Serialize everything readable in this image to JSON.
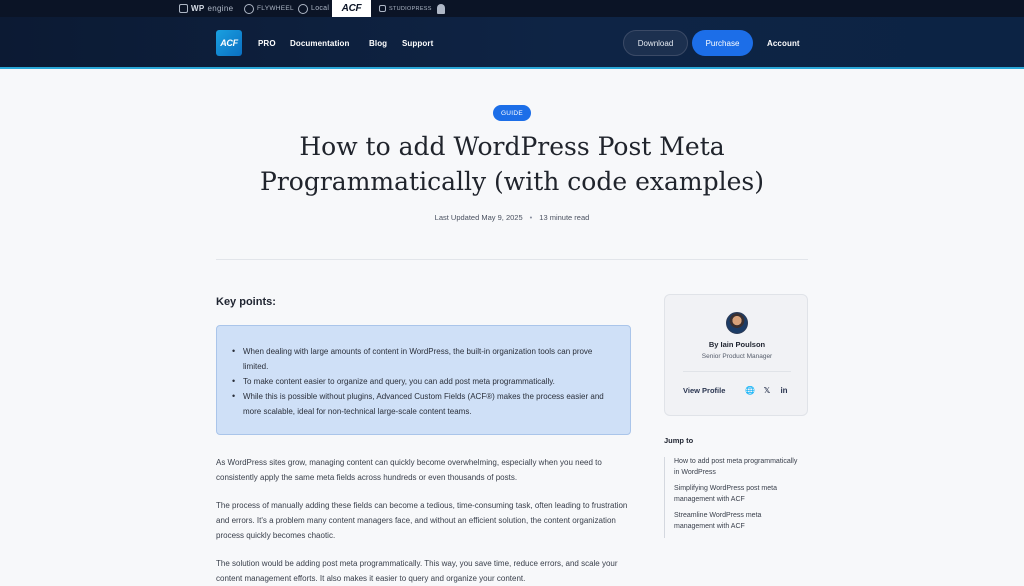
{
  "brand_strip": {
    "wpengine": {
      "bold": "WP",
      "rest": "engine"
    },
    "flywheel": "FLYWHEEL",
    "local": "Local",
    "acf": "ACF",
    "studiopress": "STUDIOPRESS"
  },
  "nav": {
    "logo": "ACF",
    "links": [
      "PRO",
      "Documentation",
      "Blog",
      "Support"
    ],
    "download": "Download",
    "purchase": "Purchase",
    "account": "Account"
  },
  "article": {
    "badge": "GUIDE",
    "title": "How to add WordPress Post Meta Programmatically (with code examples)",
    "updated": "Last Updated May 9, 2025",
    "separator": "•",
    "read_time": "13 minute read",
    "key_points_heading": "Key points:",
    "key_points": [
      "When dealing with large amounts of content in WordPress, the built-in organization tools can prove limited.",
      "To make content easier to organize and query, you can add post meta programmatically.",
      "While this is possible without plugins, Advanced Custom Fields (ACF®) makes the process easier and more scalable, ideal for non-technical large-scale content teams."
    ],
    "paragraphs": [
      "As WordPress sites grow, managing content can quickly become overwhelming, especially when you need to consistently apply the same meta fields across hundreds or even thousands of posts.",
      "The process of manually adding these fields can become a tedious, time-consuming task, often leading to frustration and errors. It's a problem many content managers face, and without an efficient solution, the content organization process quickly becomes chaotic.",
      "The solution would be adding post meta programmatically. This way, you save time, reduce errors, and scale your content management efforts. It also makes it easier to query and organize your content."
    ]
  },
  "author": {
    "name": "By Iain Poulson",
    "role": "Senior Product Manager",
    "view_profile": "View Profile",
    "socials": [
      "globe-icon",
      "x-icon",
      "linkedin-icon"
    ],
    "social_glyphs": {
      "web": "🌐",
      "x": "𝕏",
      "in": "in"
    }
  },
  "jump_to": {
    "title": "Jump to",
    "items": [
      "How to add post meta programmatically in WordPress",
      "Simplifying WordPress post meta management with ACF",
      "Streamline WordPress meta management with ACF"
    ]
  },
  "colors": {
    "accent": "#1c6ee8",
    "nav_bg": "#0e2445",
    "callout_bg": "#cfe0f7"
  }
}
